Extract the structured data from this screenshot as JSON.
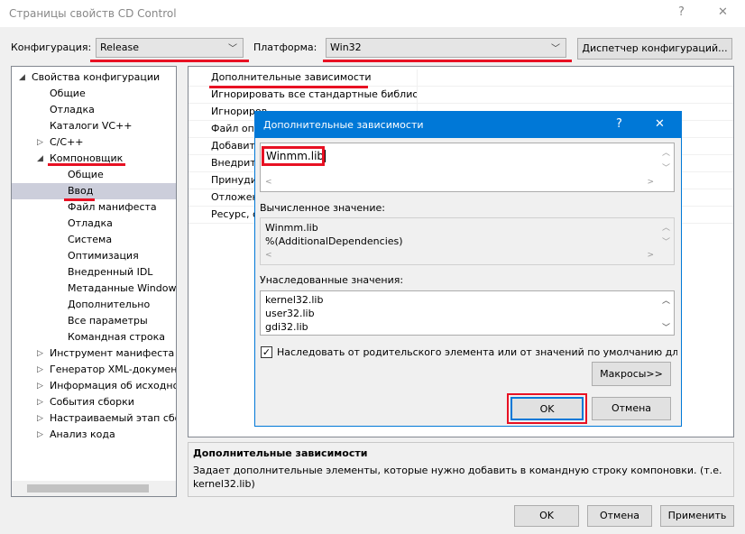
{
  "window": {
    "title": "Страницы свойств CD Control",
    "help": "?",
    "close": "✕"
  },
  "toolbar": {
    "config_label": "Конфигурация:",
    "config_value": "Release",
    "platform_label": "Платформа:",
    "platform_value": "Win32",
    "config_manager": "Диспетчер конфигураций..."
  },
  "tree": {
    "items": [
      {
        "label": "Свойства конфигурации",
        "level": 0,
        "expander": "expanded"
      },
      {
        "label": "Общие",
        "level": 1
      },
      {
        "label": "Отладка",
        "level": 1
      },
      {
        "label": "Каталоги VC++",
        "level": 1
      },
      {
        "label": "C/C++",
        "level": 1,
        "expander": "collapsed"
      },
      {
        "label": "Компоновщик",
        "level": 1,
        "expander": "expanded"
      },
      {
        "label": "Общие",
        "level": 2
      },
      {
        "label": "Ввод",
        "level": 2,
        "selected": true
      },
      {
        "label": "Файл манифеста",
        "level": 2
      },
      {
        "label": "Отладка",
        "level": 2
      },
      {
        "label": "Система",
        "level": 2
      },
      {
        "label": "Оптимизация",
        "level": 2
      },
      {
        "label": "Внедренный IDL",
        "level": 2
      },
      {
        "label": "Метаданные Windows",
        "level": 2
      },
      {
        "label": "Дополнительно",
        "level": 2
      },
      {
        "label": "Все параметры",
        "level": 2
      },
      {
        "label": "Командная строка",
        "level": 2
      },
      {
        "label": "Инструмент манифеста",
        "level": 1,
        "expander": "collapsed"
      },
      {
        "label": "Генератор XML-документ",
        "level": 1,
        "expander": "collapsed"
      },
      {
        "label": "Информация об исходно",
        "level": 1,
        "expander": "collapsed"
      },
      {
        "label": "События сборки",
        "level": 1,
        "expander": "collapsed"
      },
      {
        "label": "Настраиваемый этап сбо",
        "level": 1,
        "expander": "collapsed"
      },
      {
        "label": "Анализ кода",
        "level": 1,
        "expander": "collapsed"
      }
    ]
  },
  "properties": {
    "rows": [
      "Дополнительные зависимости",
      "Игнорировать все стандартные библиоте",
      "Игнориров",
      "Файл опр",
      "Добавить",
      "Внедрить",
      "Принуди",
      "Отложен",
      "Ресурс, с"
    ]
  },
  "description": {
    "title": "Дополнительные зависимости",
    "text": "Задает дополнительные элементы, которые нужно добавить в командную строку компоновки. (т.е. kernel32.lib)"
  },
  "footer": {
    "ok": "OK",
    "cancel": "Отмена",
    "apply": "Применить"
  },
  "dialog": {
    "title": "Дополнительные зависимости",
    "help": "?",
    "close": "✕",
    "edit_value": "Winmm.lib",
    "computed_label": "Вычисленное значение:",
    "computed_lines": [
      "Winmm.lib",
      "%(AdditionalDependencies)"
    ],
    "inherited_label": "Унаследованные значения:",
    "inherited_lines": [
      "kernel32.lib",
      "user32.lib",
      "gdi32.lib"
    ],
    "inherit_checkbox": "Наследовать от родительского элемента или от значений по умолчанию для пр",
    "inherit_checked": true,
    "macros": "Макросы>>",
    "ok": "OK",
    "cancel": "Отмена",
    "accent": "#0078d7"
  }
}
